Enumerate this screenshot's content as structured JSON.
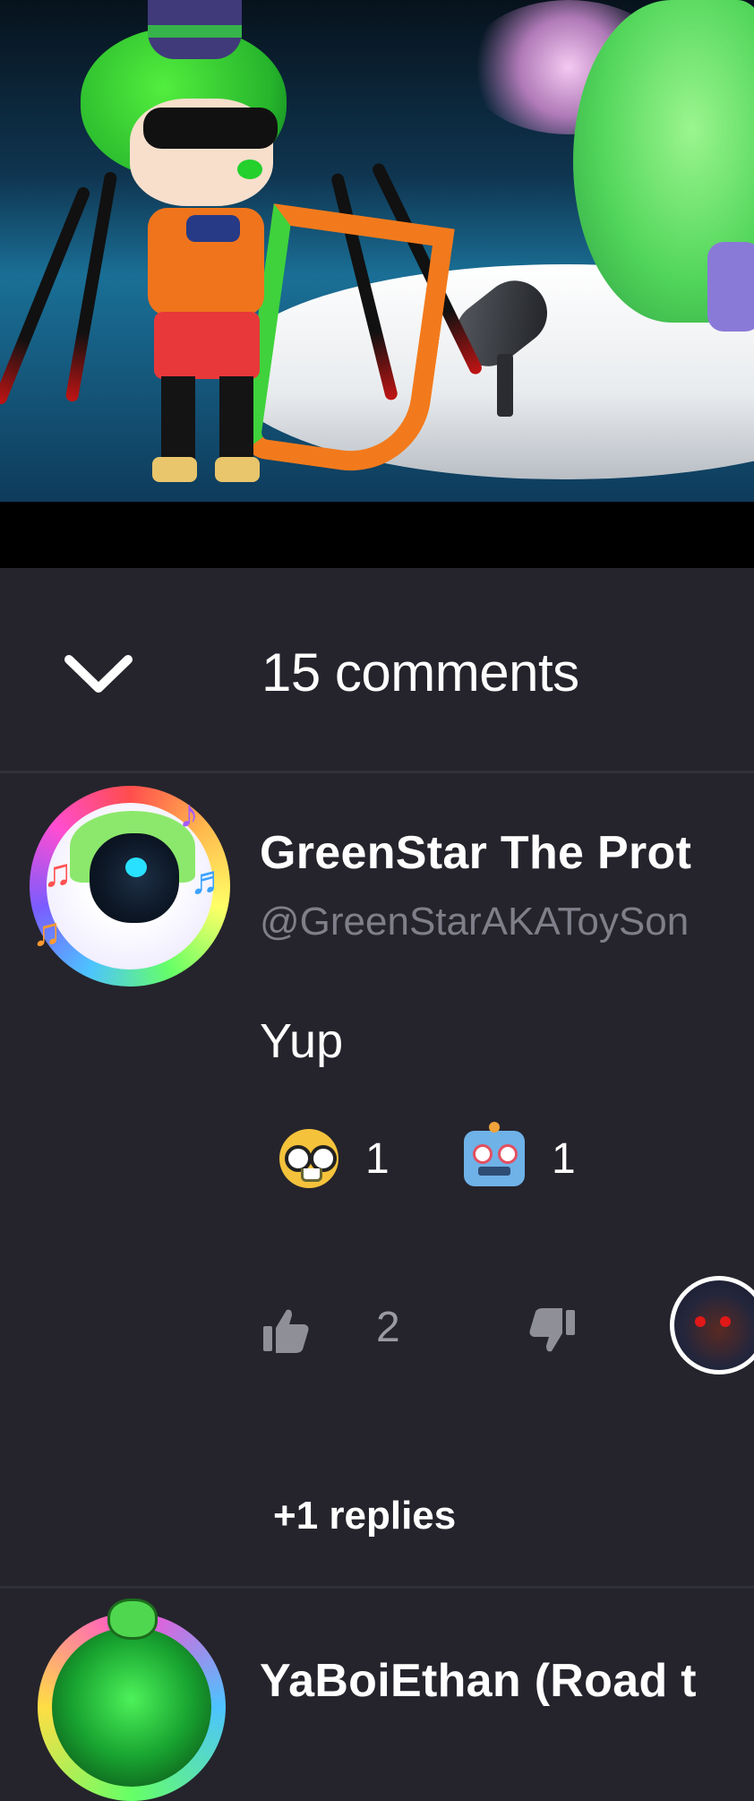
{
  "video": {
    "thumbnail_icon": "gacha-character-scene-image"
  },
  "comments_header": {
    "count_label": "15 comments",
    "collapse_icon": "chevron-down-icon"
  },
  "comments": [
    {
      "author_name": "GreenStar The Prot",
      "author_handle": "@GreenStarAKAToySon",
      "text": "Yup",
      "reactions": [
        {
          "emoji": "nerd-face-emoji",
          "count": "1"
        },
        {
          "emoji": "robot-emoji",
          "count": "1"
        }
      ],
      "like_count": "2",
      "replies_label": "+1 replies"
    },
    {
      "author_name": "YaBoiEthan (Road t"
    }
  ],
  "colors": {
    "background": "#25242c",
    "divider": "#303038",
    "muted_text": "#7f7f8a",
    "text": "#ffffff"
  }
}
